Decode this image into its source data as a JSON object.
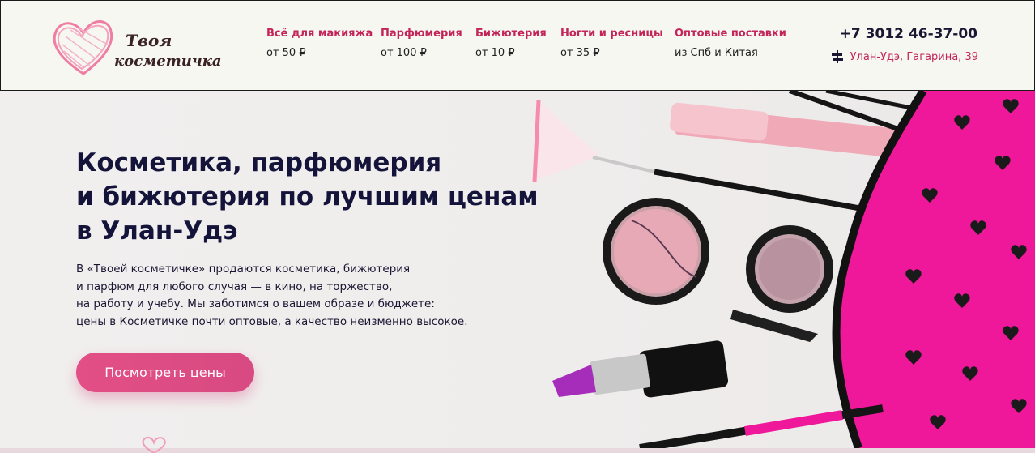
{
  "header": {
    "logo": {
      "line1": "Твоя",
      "line2": "косметичка"
    },
    "nav": [
      {
        "title": "Всё для макияжа",
        "sub": "от 50 ₽"
      },
      {
        "title": "Парфюмерия",
        "sub": "от 100 ₽"
      },
      {
        "title": "Бижютерия",
        "sub": "от 10 ₽"
      },
      {
        "title": "Ногти и ресницы",
        "sub": "от 35 ₽"
      },
      {
        "title": "Оптовые поставки",
        "sub": "из Спб и Китая"
      }
    ],
    "phone": "+7 3012 46-37-00",
    "address": "Улан-Удэ, Гагарина, 39"
  },
  "hero": {
    "title_lines": [
      "Косметика, парфюмерия",
      "и бижютерия по лучшим ценам",
      "в Улан-Удэ"
    ],
    "text_lines": [
      "В «Твоей косметичке» продаются косметика, бижютерия",
      "и парфюм для любого случая — в кино, на торжество,",
      "на работу и учебу. Мы заботимся о вашем образе и бюджете:",
      "цены в Косметичке почти оптовые, а качество неизменно высокое."
    ],
    "cta_label": "Посмотреть цены"
  },
  "colors": {
    "accent": "#c3245a",
    "button": "#e04f85",
    "title": "#14133a",
    "header_bg": "#f7f7f1",
    "pouch": "#f0189a"
  },
  "icons": {
    "address": "signpost-icon",
    "logo": "heart-logo-icon"
  }
}
